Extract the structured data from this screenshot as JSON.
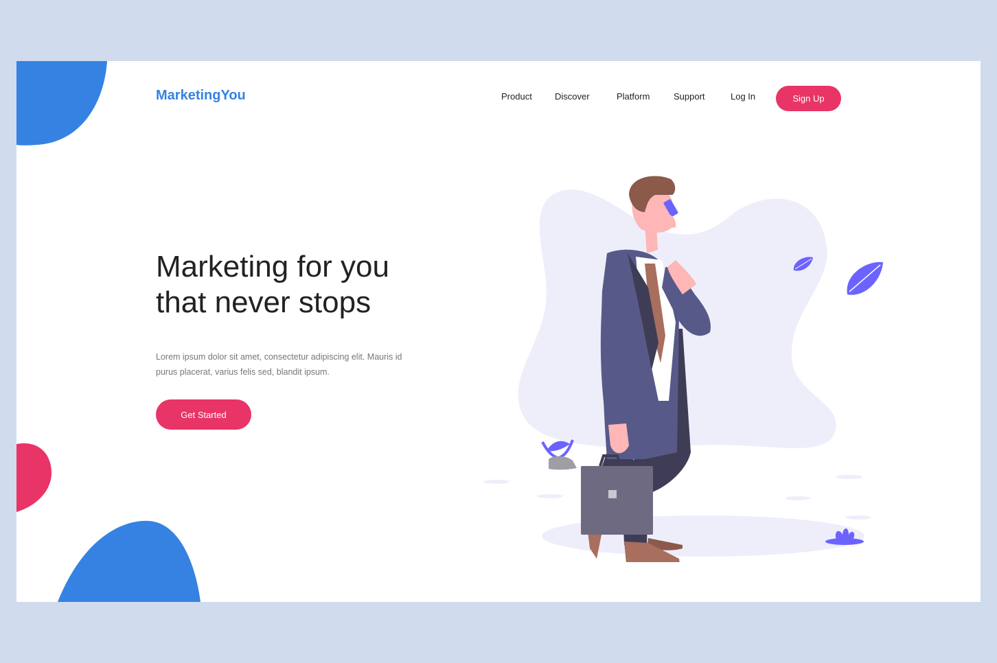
{
  "brand": {
    "name": "MarketingYou",
    "color": "#3582e2"
  },
  "nav": {
    "items": [
      "Product",
      "Discover",
      "Platform",
      "Support",
      "Log In"
    ],
    "signup_label": "Sign Up"
  },
  "hero": {
    "title_line1": "Marketing for you",
    "title_line2": "that never stops",
    "text_line1": "Lorem ipsum dolor sit amet, consectetur adipiscing elit. Mauris id",
    "text_line2": "purus placerat, varius felis sed, blandit ipsum.",
    "cta_label": "Get Started"
  },
  "colors": {
    "accent": "#e83466",
    "blob_blue": "#3582e2",
    "blob_pink": "#e83466",
    "background": "#d0dcee",
    "illustration_tint": "#eeeefb",
    "leaf": "#6c63ff"
  },
  "illustration": "businessman-on-phone-with-briefcase"
}
